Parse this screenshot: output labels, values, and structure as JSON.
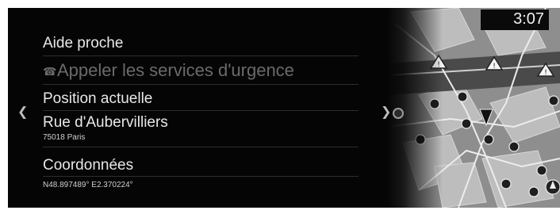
{
  "status": {
    "time": "3:07"
  },
  "panel": {
    "title": "Aide proche",
    "emergency_label": "Appeler les services d'urgence",
    "current_position_heading": "Position actuelle",
    "street": "Rue d'Aubervilliers",
    "postal_city": "75018 Paris",
    "coordinates_heading": "Coordonnées",
    "coordinates_value": "N48.897489° E2.370224°"
  },
  "icons": {
    "prev": "chevron-left-icon",
    "next": "chevron-right-icon",
    "phone": "phone-icon",
    "map_warning": "warning-triangle-icon",
    "map_poi": "poi-pin-icon",
    "vehicle": "vehicle-position-icon",
    "compass": "compass-icon"
  }
}
